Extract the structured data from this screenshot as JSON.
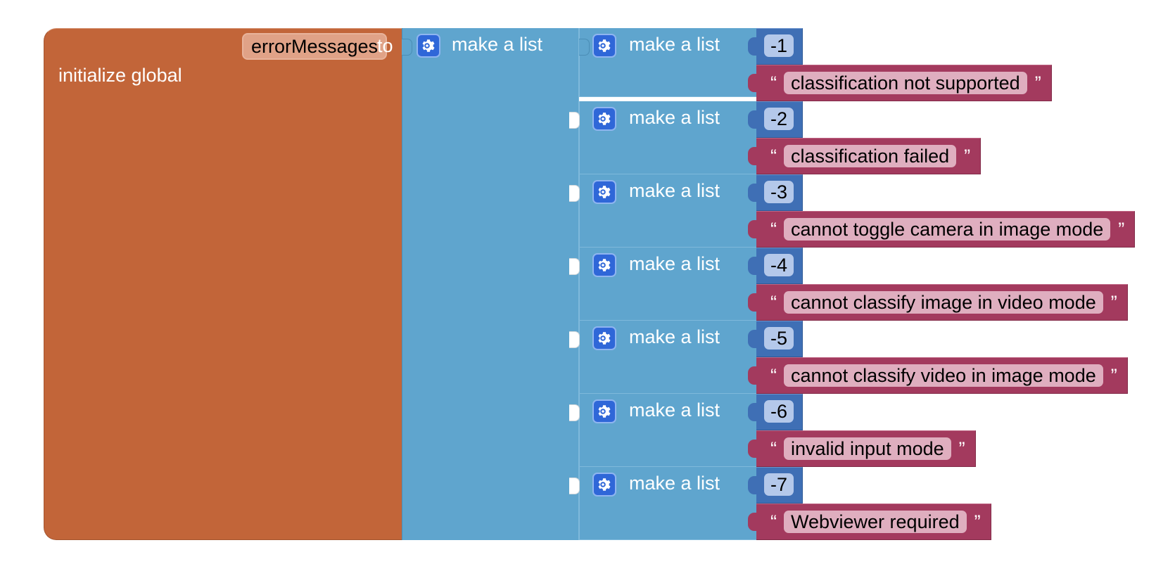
{
  "init_block": {
    "prefix_label": "initialize global",
    "variable_name": "errorMessages",
    "suffix_label": "to",
    "color": "#c26539"
  },
  "outer_list": {
    "label": "make a list",
    "icon": "gear-icon",
    "color": "#5fa5ce"
  },
  "rows": [
    {
      "list_label": "make a list",
      "number": "-1",
      "text": "classification not supported"
    },
    {
      "list_label": "make a list",
      "number": "-2",
      "text": "classification failed"
    },
    {
      "list_label": "make a list",
      "number": "-3",
      "text": "cannot toggle camera in image mode"
    },
    {
      "list_label": "make a list",
      "number": "-4",
      "text": "cannot classify image in video mode"
    },
    {
      "list_label": "make a list",
      "number": "-5",
      "text": "cannot classify video in image mode"
    },
    {
      "list_label": "make a list",
      "number": "-6",
      "text": "invalid input mode"
    },
    {
      "list_label": "make a list",
      "number": "-7",
      "text": "Webviewer required"
    }
  ],
  "quotes": {
    "open": "“",
    "close": "”"
  },
  "colors": {
    "number_block": "#3f6fb5",
    "text_block": "#a33a5e",
    "gear_button": "#2f67d8"
  }
}
